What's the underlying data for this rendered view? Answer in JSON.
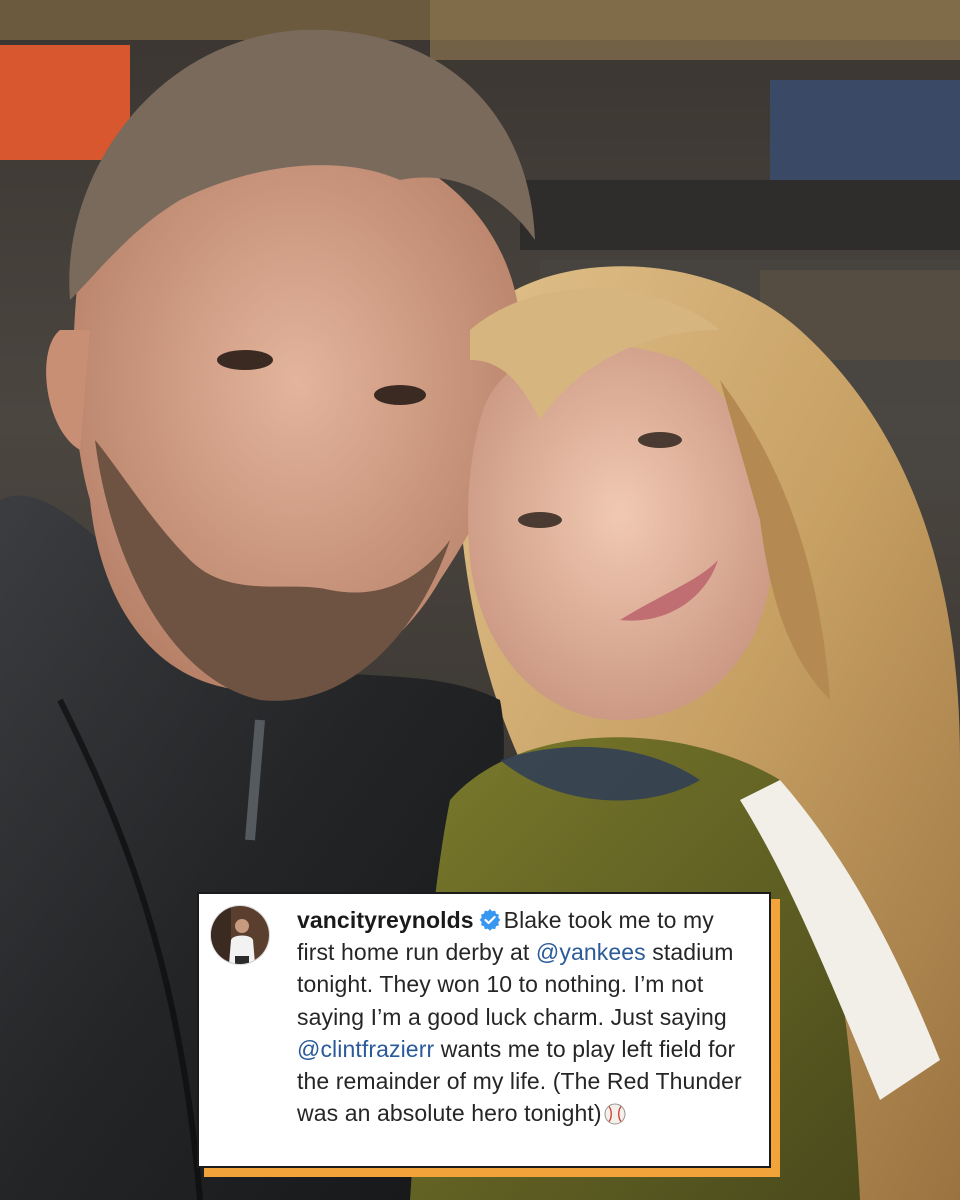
{
  "photo": {
    "description_icon": "selfie-photo"
  },
  "post": {
    "username": "vancityreynolds",
    "verified_icon": "verified-badge-icon",
    "text_part1": "Blake took me to my first home run derby at",
    "mention1": "@yankees",
    "text_part2": "stadium tonight. They won 10 to nothing. I’m not saying I’m a good luck charm. Just saying",
    "mention2": "@clintfrazierr",
    "text_part3": "wants me to play left field for the remainder of my life. (The Red Thunder was an absolute hero tonight)",
    "emoji_icon": "baseball-icon"
  },
  "colors": {
    "accent_shadow": "#f2a33a",
    "mention": "#2a5a99",
    "verified": "#3897f0"
  }
}
